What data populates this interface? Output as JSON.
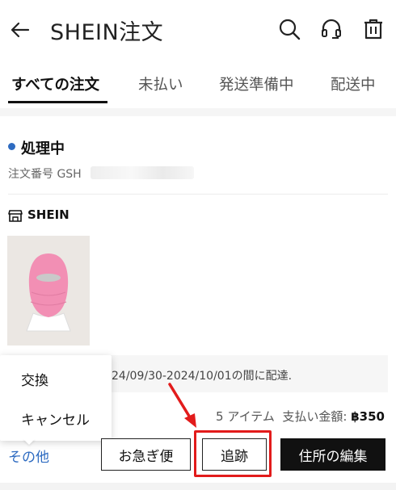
{
  "header": {
    "title": "SHEIN注文"
  },
  "tabs": [
    {
      "label": "すべての注文",
      "active": true
    },
    {
      "label": "未払い",
      "active": false
    },
    {
      "label": "発送準備中",
      "active": false
    },
    {
      "label": "配送中",
      "active": false
    }
  ],
  "order": {
    "status": "処理中",
    "order_number_label": "注文番号 GSH",
    "store": "SHEIN",
    "delivery_note": "24/09/30-2024/10/01の間に配達.",
    "summary_items": "5 アイテム",
    "summary_label": "支払い金額:",
    "summary_amount": "฿350"
  },
  "popup_menu": {
    "items": [
      "交換",
      "キャンセル"
    ]
  },
  "actions": {
    "more": "その他",
    "urgent": "お急ぎ便",
    "track": "追跡",
    "edit_address": "住所の編集"
  },
  "colors": {
    "accent_blue": "#2e6bc1",
    "highlight_red": "#e21b1b",
    "product_pink": "#f28fb4"
  },
  "icons": [
    "back-arrow-icon",
    "search-icon",
    "headset-icon",
    "trash-icon",
    "store-icon"
  ]
}
